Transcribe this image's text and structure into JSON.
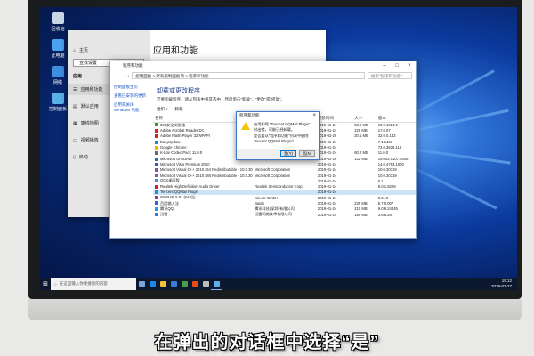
{
  "desktop_icons": [
    {
      "label": "回收站"
    },
    {
      "label": "此电脑"
    },
    {
      "label": "网络"
    },
    {
      "label": "控制面板"
    }
  ],
  "settings": {
    "home": "主页",
    "search_placeholder": "查找设置",
    "section": "应用",
    "nav": [
      "应用和功能",
      "默认应用",
      "离线地图",
      "视频播放",
      "启动"
    ],
    "page_title": "应用和功能"
  },
  "control_panel": {
    "title": "程序和功能",
    "address": "控制面板 > 所有控制面板项 > 程序和功能",
    "search_placeholder": "搜索“程序和功能”",
    "left_links": [
      "控制面板主页",
      "查看已安装的更新",
      "启用或关闭 Windows 功能"
    ],
    "heading": "卸载或更改程序",
    "description": "若要卸载程序，请从列表中将其选中，然后单击“卸载”、“更改”或“修复”。",
    "toolbar": [
      "组织 ▾",
      "卸载"
    ],
    "columns": [
      "名称",
      "发布者",
      "安装时间",
      "大小",
      "版本"
    ],
    "rows": [
      {
        "name": "360安全浏览器",
        "publisher": "",
        "date": "2019-01-24",
        "size": "53.2 MB",
        "version": "10.0.1024.0",
        "color": "#2e9b3c"
      },
      {
        "name": "Adobe Acrobat Reader DC",
        "publisher": "",
        "date": "2019-01-24",
        "size": "226 MB",
        "version": "17.0.07",
        "color": "#d82222"
      },
      {
        "name": "Adobe Flash Player 32 NPAPI",
        "publisher": "",
        "date": "2019-02-26",
        "size": "20.1 MB",
        "version": "32.0.0.142",
        "color": "#c42b2b"
      },
      {
        "name": "EasyUpdate",
        "publisher": "",
        "date": "2019-01-24",
        "size": "",
        "version": "7.1.1467",
        "color": "#3a7bd5"
      },
      {
        "name": "Google Chrome",
        "publisher": "",
        "date": "2019-01-24",
        "size": "",
        "version": "72.0.3626.119",
        "color": "#f2b400"
      },
      {
        "name": "K-Lite Codec Pack 11.0.0",
        "publisher": "",
        "date": "2019-01-24",
        "size": "60.2 MB",
        "version": "11.0.0",
        "color": "#6a6a6a"
      },
      {
        "name": "Microsoft OneDrive",
        "publisher": "",
        "date": "2019-02-26",
        "size": "132 MB",
        "version": "19.002.0107.0008",
        "color": "#1f6fd1"
      },
      {
        "name": "Microsoft Visio Premium 2010",
        "publisher": "",
        "date": "2019-01-24",
        "size": "",
        "version": "14.0.4763.1000",
        "color": "#2a5cb8"
      },
      {
        "name": "Microsoft Visual C++ 2010 x64 Redistributable - 10.0.30319",
        "publisher": "Microsoft Corporation",
        "date": "2019-01-24",
        "size": "",
        "version": "10.0.30319",
        "color": "#7d5ab0"
      },
      {
        "name": "Microsoft Visual C++ 2010 x86 Redistributable - 10.0.30319",
        "publisher": "Microsoft Corporation",
        "date": "2019-01-24",
        "size": "",
        "version": "10.0.30319",
        "color": "#7d5ab0"
      },
      {
        "name": "OCS桌面版",
        "publisher": "",
        "date": "2019-01-24",
        "size": "",
        "version": "6.1",
        "color": "#3a9bd8"
      },
      {
        "name": "Realtek High Definition Audio Driver",
        "publisher": "Realtek Semiconductor Corp.",
        "date": "2019-01-24",
        "size": "",
        "version": "6.0.1.8229",
        "color": "#c8262f"
      },
      {
        "name": "Tencent QQMail Plugin",
        "publisher": "",
        "date": "2019-01-24",
        "size": "",
        "version": "",
        "color": "#2a8ae0",
        "selected": true
      },
      {
        "name": "WinRAR 5.61 (64-位)",
        "publisher": "win.rar GmbH",
        "date": "2019-01-24",
        "size": "",
        "version": "5.61.0",
        "color": "#8a3d9b"
      },
      {
        "name": "百度输入法",
        "publisher": "Baidu",
        "date": "2019-01-24",
        "size": "235 MB",
        "version": "5.7.0.007",
        "color": "#2b65d9"
      },
      {
        "name": "腾讯QQ",
        "publisher": "腾讯科技(深圳)有限公司",
        "date": "2019-01-24",
        "size": "215 MB",
        "version": "9.0.9.24445",
        "color": "#1ea0e8"
      },
      {
        "name": "迅雷",
        "publisher": "迅雷网络技术有限公司",
        "date": "2019-01-24",
        "size": "180 MB",
        "version": "3.8.6.28",
        "color": "#2d7ae0"
      }
    ]
  },
  "dialog": {
    "title": "程序和功能",
    "message1": "启用卸载 \"Tencent QQMail Plugin\" 时出错，可能已经卸载。",
    "message2": "是否要从\"程序和功能\"列表中删除 Tencent QQMail Plugin？",
    "yes": "是(Y)",
    "no": "否(N)"
  },
  "taskbar": {
    "search_placeholder": "在这里输入你要搜索的内容",
    "time": "19:12",
    "date": "2019-02-27"
  },
  "subtitle": "在弹出的对话框中选择“是”"
}
